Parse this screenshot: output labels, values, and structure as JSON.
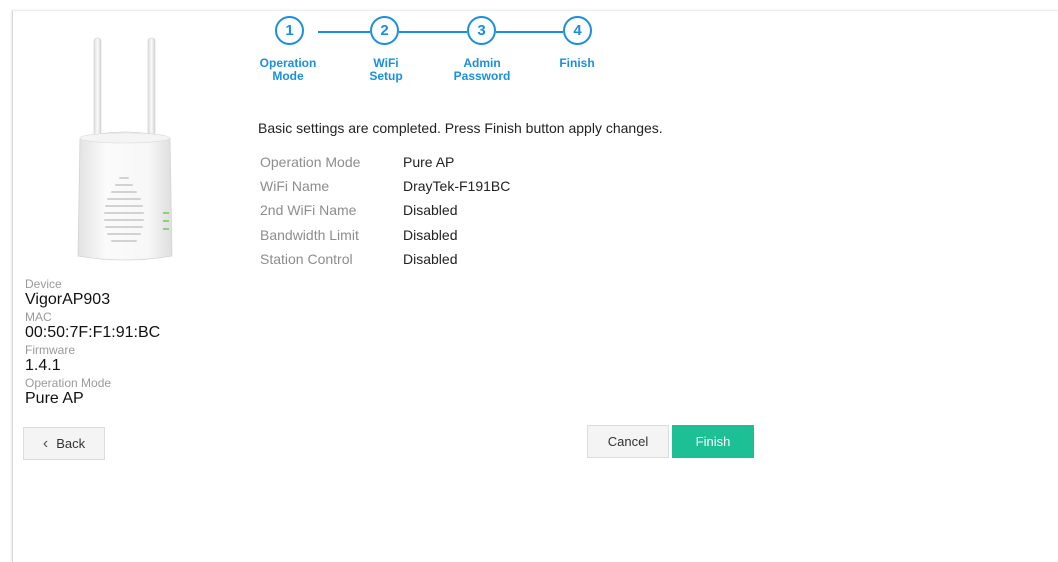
{
  "steps": [
    {
      "num": "1",
      "label": "Operation\nMode"
    },
    {
      "num": "2",
      "label": "WiFi\nSetup"
    },
    {
      "num": "3",
      "label": "Admin\nPassword"
    },
    {
      "num": "4",
      "label": "Finish"
    }
  ],
  "summary": {
    "title": "Basic settings are completed. Press Finish button apply changes.",
    "rows": [
      {
        "key": "Operation Mode",
        "value": "Pure AP"
      },
      {
        "key": "WiFi Name",
        "value": "DrayTek-F191BC"
      },
      {
        "key": "2nd WiFi Name",
        "value": "Disabled"
      },
      {
        "key": "Bandwidth Limit",
        "value": "Disabled"
      },
      {
        "key": "Station Control",
        "value": "Disabled"
      }
    ]
  },
  "device_info": {
    "device_label": "Device",
    "device_value": "VigorAP903",
    "mac_label": "MAC",
    "mac_value": "00:50:7F:F1:91:BC",
    "firmware_label": "Firmware",
    "firmware_value": "1.4.1",
    "mode_label": "Operation Mode",
    "mode_value": "Pure AP"
  },
  "buttons": {
    "back": "Back",
    "cancel": "Cancel",
    "finish": "Finish"
  },
  "colors": {
    "accent": "#1a8fe0",
    "finish": "#1dbf94"
  }
}
